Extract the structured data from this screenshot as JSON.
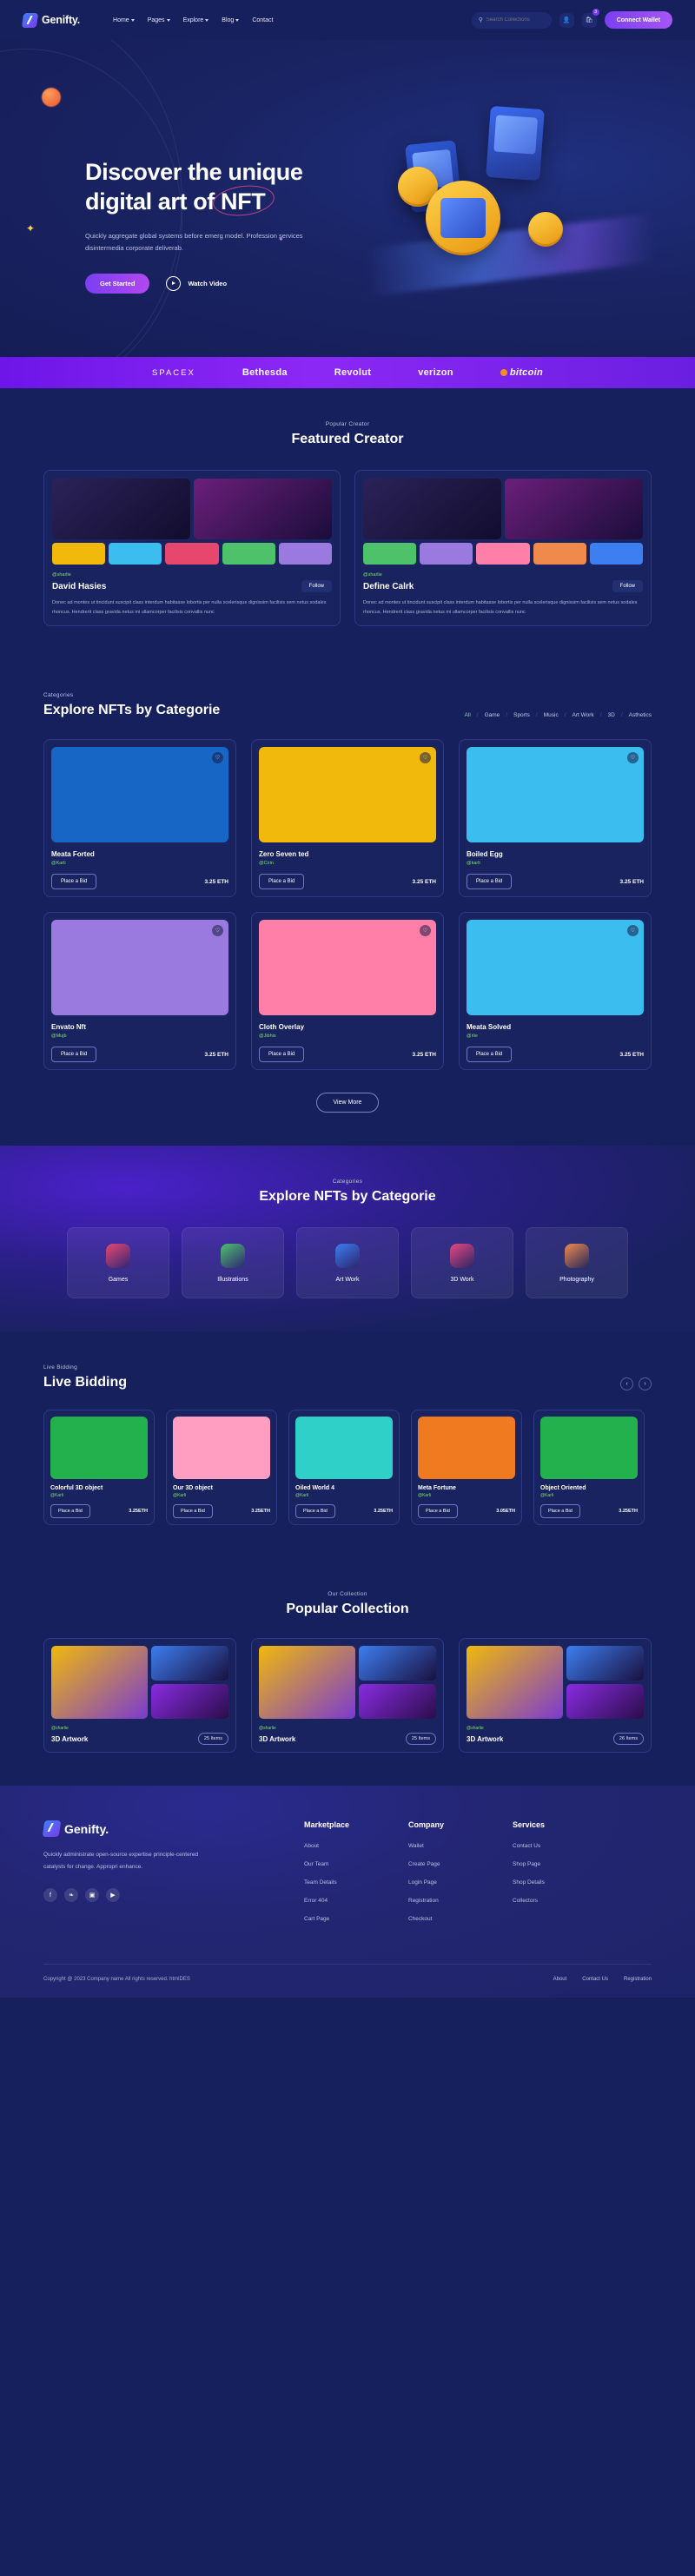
{
  "brand": {
    "name": "Genifty."
  },
  "nav": {
    "items": [
      {
        "label": "Home",
        "caret": true
      },
      {
        "label": "Pages",
        "caret": true
      },
      {
        "label": "Explore",
        "caret": true
      },
      {
        "label": "Blog",
        "caret": true
      },
      {
        "label": "Contact",
        "caret": false
      }
    ],
    "search_placeholder": "Search Collections",
    "cart_badge": "3",
    "connect_label": "Connect Wallet"
  },
  "hero": {
    "title_line1": "Discover the unique",
    "title_line2_pre": "digital art of ",
    "title_line2_highlight": "NFT",
    "description": "Quickly aggregate global systems before emerg model. Profession services disintermedia corporate deliverab.",
    "primary_cta": "Get Started",
    "secondary_cta": "Watch Video"
  },
  "brands": [
    {
      "name": "SPACEX",
      "style": "spacex"
    },
    {
      "name": "Bethesda",
      "style": "plain"
    },
    {
      "name": "Revolut",
      "style": "plain"
    },
    {
      "name": "verizon",
      "style": "plain"
    },
    {
      "name": "bitcoin",
      "style": "bitcoin"
    }
  ],
  "featured": {
    "eyebrow": "Popular Creator",
    "title": "Featured Creator",
    "follow_label": "Follow",
    "creators": [
      {
        "handle": "@sharlie",
        "name": "David Hasies",
        "description": "Donec ad montes ut tincidunt suscipit class interdum habitasse lobortis per nulla scelerisque dignissim facilisis sem netus sodales rhoncus. Hendrerit class gravida netus mi ullamcorper facilisis convallis nunc"
      },
      {
        "handle": "@sharlie",
        "name": "Define Calrk",
        "description": "Donec ad montes ut tincidunt suscipit class interdum habitasse lobortis per nulla scelerisque dignissim facilisis sem netus sodales rhoncus. Hendrerit class gravida netus mi ullamcorper facilisis convallis nunc"
      }
    ]
  },
  "explore": {
    "eyebrow": "Categories",
    "title": "Explore NFTs by Categorie",
    "filters": [
      "All",
      "Game",
      "Sports",
      "Music",
      "Art Work",
      "3D",
      "Asthetics"
    ],
    "active_filter": "All",
    "bid_label": "Place a Bid",
    "view_more_label": "View More",
    "items": [
      {
        "name": "Meata Forted",
        "handle": "@Karli",
        "price": "3.25 ETH",
        "bg": "#1766c6"
      },
      {
        "name": "Zero Seven ted",
        "handle": "@Cirin",
        "price": "3.25 ETH",
        "bg": "#f0b90b"
      },
      {
        "name": "Boiled Egg",
        "handle": "@karli",
        "price": "3.25 ETH",
        "bg": "#3bbdf0"
      },
      {
        "name": "Envato Nft",
        "handle": "@Mujb",
        "price": "3.25 ETH",
        "bg": "#9b7ae0"
      },
      {
        "name": "Cloth Overlay",
        "handle": "@Jibhis",
        "price": "3.25 ETH",
        "bg": "#ff7fa8"
      },
      {
        "name": "Meata Solved",
        "handle": "@rlie",
        "price": "3.25 ETH",
        "bg": "#3bbdf0"
      }
    ]
  },
  "categories": {
    "eyebrow": "Categories",
    "title": "Explore NFTs by Categorie",
    "items": [
      {
        "label": "Games",
        "icon": "apple-icon",
        "color": "#e8476d"
      },
      {
        "label": "Illustrations",
        "icon": "pencil-icon",
        "color": "#4ec26a"
      },
      {
        "label": "Art Work",
        "icon": "image-icon",
        "color": "#3d7ef0"
      },
      {
        "label": "3D Work",
        "icon": "gear-icon",
        "color": "#e8487f"
      },
      {
        "label": "Photography",
        "icon": "camera-icon",
        "color": "#ef8a4b"
      }
    ]
  },
  "live_bidding": {
    "eyebrow": "Live Bidding",
    "title": "Live Bidding",
    "prev_icon": "chevron-left-icon",
    "next_icon": "chevron-right-icon",
    "bid_label": "Place a Bid",
    "items": [
      {
        "name": "Colorful 3D object",
        "handle": "@Karli",
        "price": "3.25ETH",
        "bg": "#22b14c"
      },
      {
        "name": "Our 3D object",
        "handle": "@Karli",
        "price": "3.25ETH",
        "bg": "#ff9ec0"
      },
      {
        "name": "Oiled World 4",
        "handle": "@Karli",
        "price": "3.25ETH",
        "bg": "#2fd0c8"
      },
      {
        "name": "Meta Fortune",
        "handle": "@Karli",
        "price": "3.05ETH",
        "bg": "#f07a1f"
      },
      {
        "name": "Object Oriented",
        "handle": "@Karli",
        "price": "3.25ETH",
        "bg": "#22b14c"
      }
    ]
  },
  "collection": {
    "eyebrow": "Our Collection",
    "title": "Popular Collection",
    "items": [
      {
        "handle": "@sharlie",
        "name": "3D Artwork",
        "items_count": "25 Items"
      },
      {
        "handle": "@sharlie",
        "name": "3D Artwork",
        "items_count": "25 Items"
      },
      {
        "handle": "@sharlie",
        "name": "3D Artwork",
        "items_count": "26 Items"
      }
    ]
  },
  "footer": {
    "description": "Quickly administrate open-source expertise principle-centered catalysts for change. Appropri enhance.",
    "socials": [
      {
        "name": "facebook-icon",
        "glyph": "f"
      },
      {
        "name": "twitter-icon",
        "glyph": "❧"
      },
      {
        "name": "instagram-icon",
        "glyph": "▣"
      },
      {
        "name": "youtube-icon",
        "glyph": "▶"
      }
    ],
    "columns": [
      {
        "title": "Marketplace",
        "links": [
          "About",
          "Our Team",
          "Team Details",
          "Error 404",
          "Cart Page"
        ]
      },
      {
        "title": "Company",
        "links": [
          "Wallet",
          "Create Page",
          "Login Page",
          "Registration",
          "Checkout"
        ]
      },
      {
        "title": "Services",
        "links": [
          "Contact Us",
          "Shop Page",
          "Shop Details",
          "Collectors"
        ]
      }
    ],
    "copyright": "Copyright @ 2023 Company name All rights reserved. htmlDES",
    "bottom_links": [
      "About",
      "Contact Us",
      "Registration"
    ]
  }
}
